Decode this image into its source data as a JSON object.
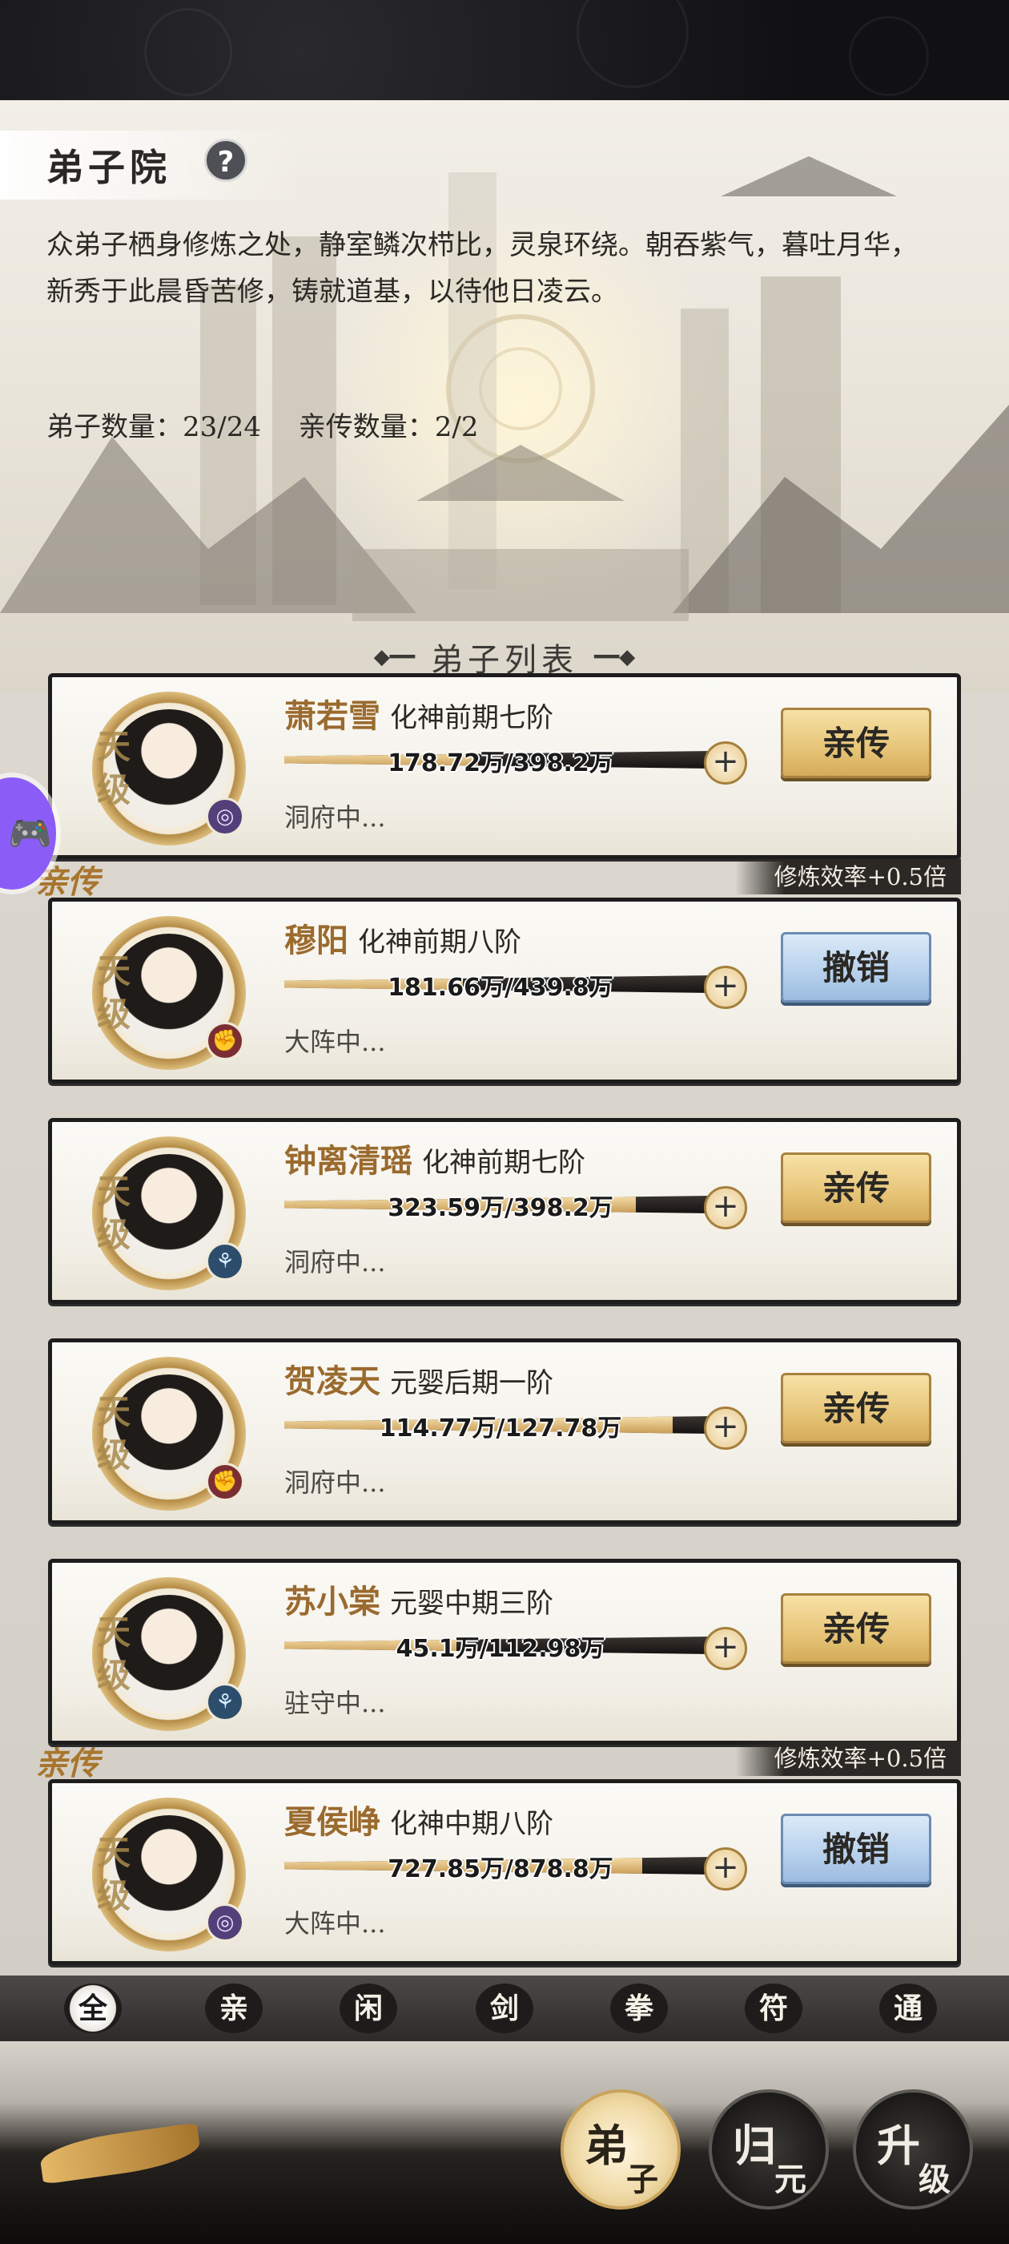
{
  "header": {
    "title": "弟子院",
    "help_icon": "question-icon",
    "description": "众弟子栖身修炼之处，静室鳞次栉比，灵泉环绕。朝吞紫气，暮吐月华，新秀于此晨昏苦修，铸就道基，以待他日凌云。",
    "disciple_count_label": "弟子数量：23/24",
    "core_count_label": "亲传数量：2/2"
  },
  "list": {
    "title": "弟子列表",
    "tag_label": "亲传",
    "efficiency_label": "修炼效率+0.5倍",
    "grade_label": "天级",
    "disciples": [
      {
        "name": "萧若雪",
        "realm": "化神前期七阶",
        "exp": "178.72万/398.2万",
        "progress": 0.449,
        "status": "洞府中...",
        "action": "亲传",
        "element_icon": "swirl-icon",
        "is_core": false
      },
      {
        "name": "穆阳",
        "realm": "化神前期八阶",
        "exp": "181.66万/439.8万",
        "progress": 0.413,
        "status": "大阵中...",
        "action": "撤销",
        "element_icon": "fist-icon",
        "is_core": true
      },
      {
        "name": "钟离清瑶",
        "realm": "化神前期七阶",
        "exp": "323.59万/398.2万",
        "progress": 0.813,
        "status": "洞府中...",
        "action": "亲传",
        "element_icon": "talisman-icon",
        "is_core": false
      },
      {
        "name": "贺凌天",
        "realm": "元婴后期一阶",
        "exp": "114.77万/127.78万",
        "progress": 0.898,
        "status": "洞府中...",
        "action": "亲传",
        "element_icon": "fist-icon",
        "is_core": false
      },
      {
        "name": "苏小棠",
        "realm": "元婴中期三阶",
        "exp": "45.1万/112.98万",
        "progress": 0.399,
        "status": "驻守中...",
        "action": "亲传",
        "element_icon": "talisman-icon",
        "is_core": false
      },
      {
        "name": "夏侯峥",
        "realm": "化神中期八阶",
        "exp": "727.85万/878.8万",
        "progress": 0.828,
        "status": "大阵中...",
        "action": "撤销",
        "element_icon": "swirl-icon",
        "is_core": true
      }
    ]
  },
  "filters": [
    "全",
    "亲",
    "闲",
    "剑",
    "拳",
    "符",
    "通"
  ],
  "bottom_nav": [
    {
      "c1": "弟",
      "c2": "子",
      "active": true
    },
    {
      "c1": "归",
      "c2": "元",
      "active": false
    },
    {
      "c1": "升",
      "c2": "级",
      "active": false
    }
  ]
}
